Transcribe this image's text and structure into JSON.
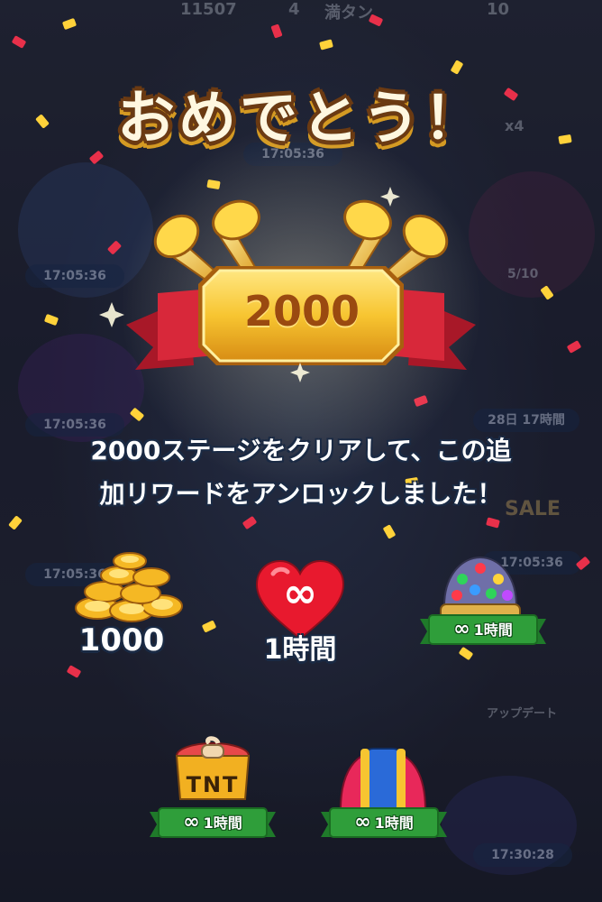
{
  "header": {
    "title": "おめでとう！"
  },
  "badge": {
    "stage_number": "2000"
  },
  "message": {
    "line1": "2000ステージをクリアして、この追",
    "line2": "加リワードをアンロックしました！"
  },
  "rewards": {
    "coins": {
      "amount": "1000",
      "icon": "coin-stack-icon"
    },
    "hearts": {
      "duration": "1時間",
      "icon": "infinite-heart-icon",
      "symbol": "∞"
    },
    "disco_ball": {
      "duration": "1時間",
      "icon": "disco-ball-booster-icon",
      "symbol": "∞"
    },
    "tnt": {
      "duration": "1時間",
      "icon": "tnt-booster-icon",
      "symbol": "∞",
      "label": "TNT"
    },
    "rocket": {
      "duration": "1時間",
      "icon": "rocket-booster-icon",
      "symbol": "∞"
    }
  },
  "background": {
    "top_bar": {
      "coins": "11507",
      "lives": "4",
      "lives_status": "満タン",
      "stars": "10"
    },
    "timers": [
      "17:05:36",
      "17:05:36",
      "17:05:36",
      "17:05:36",
      "28日 17時間",
      "17:05:36",
      "17:30:28"
    ],
    "progress": "5/10",
    "x4": "x4",
    "update_label": "アップデート",
    "sale_label": "SALE"
  },
  "colors": {
    "accent_gold": "#f4b72a",
    "ribbon_red": "#d8283a",
    "ribbon_green": "#2f9e3a",
    "title_outline": "#6b3a12"
  }
}
